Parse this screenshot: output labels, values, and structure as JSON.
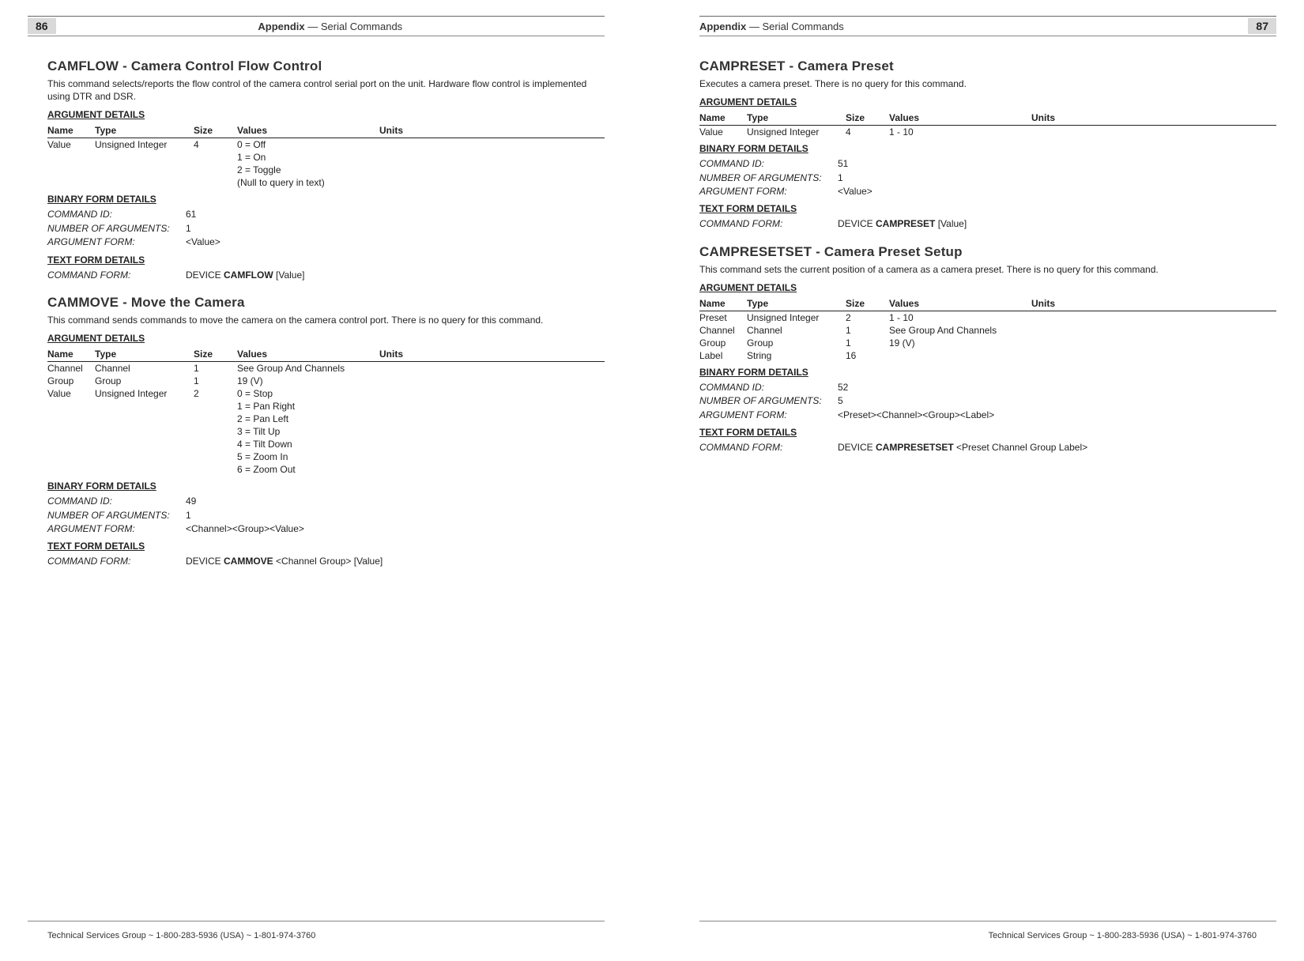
{
  "header": {
    "left_page_num": "86",
    "right_page_num": "87",
    "section_bold": "Appendix",
    "section_sep": " — ",
    "section_tail": "Serial Commands"
  },
  "footer": "Technical Services Group ~ 1-800-283-5936 (USA) ~ 1-801-974-3760",
  "labels": {
    "arg_details": "ARGUMENT DETAILS",
    "bin_details": "BINARY FORM DETAILS",
    "txt_details": "TEXT FORM DETAILS",
    "col_name": "Name",
    "col_type": "Type",
    "col_size": "Size",
    "col_values": "Values",
    "col_units": "Units",
    "cmd_id": "COMMAND ID:",
    "num_args": "NUMBER OF ARGUMENTS:",
    "arg_form": "ARGUMENT FORM:",
    "cmd_form": "COMMAND FORM:",
    "device": "DEVICE "
  },
  "camflow": {
    "title": "CAMFLOW - Camera Control Flow Control",
    "desc": "This command selects/reports the flow control of the camera control serial port on the unit. Hardware flow control is implemented using DTR and DSR.",
    "rows": [
      {
        "name": "Value",
        "type": "Unsigned Integer",
        "size": "4",
        "values": "0 = Off",
        "units": ""
      },
      {
        "name": "",
        "type": "",
        "size": "",
        "values": "1 = On",
        "units": ""
      },
      {
        "name": "",
        "type": "",
        "size": "",
        "values": "2 = Toggle",
        "units": ""
      },
      {
        "name": "",
        "type": "",
        "size": "",
        "values": "(Null to query in text)",
        "units": ""
      }
    ],
    "bin": {
      "cmd_id": "61",
      "num_args": "1",
      "arg_form": "<Value>"
    },
    "txt": {
      "cmd_bold": "CAMFLOW",
      "cmd_tail": " [Value]"
    }
  },
  "cammove": {
    "title": "CAMMOVE - Move the Camera",
    "desc": "This command sends commands to move the camera on the camera control port. There is no query for this command.",
    "rows": [
      {
        "name": "Channel",
        "type": "Channel",
        "size": "1",
        "values": "See Group And Channels",
        "units": ""
      },
      {
        "name": "Group",
        "type": "Group",
        "size": "1",
        "values": "19 (V)",
        "units": ""
      },
      {
        "name": "Value",
        "type": "Unsigned Integer",
        "size": "2",
        "values": "0 = Stop",
        "units": ""
      },
      {
        "name": "",
        "type": "",
        "size": "",
        "values": "1 = Pan Right",
        "units": ""
      },
      {
        "name": "",
        "type": "",
        "size": "",
        "values": "2 = Pan Left",
        "units": ""
      },
      {
        "name": "",
        "type": "",
        "size": "",
        "values": "3 = Tilt Up",
        "units": ""
      },
      {
        "name": "",
        "type": "",
        "size": "",
        "values": "4 = Tilt Down",
        "units": ""
      },
      {
        "name": "",
        "type": "",
        "size": "",
        "values": "5 = Zoom In",
        "units": ""
      },
      {
        "name": "",
        "type": "",
        "size": "",
        "values": "6 = Zoom Out",
        "units": ""
      }
    ],
    "bin": {
      "cmd_id": "49",
      "num_args": "1",
      "arg_form": "<Channel><Group><Value>"
    },
    "txt": {
      "cmd_bold": "CAMMOVE",
      "cmd_tail": " <Channel Group> [Value]"
    }
  },
  "campreset": {
    "title": "CAMPRESET - Camera Preset",
    "desc": "Executes a camera preset. There is no query for this command.",
    "rows": [
      {
        "name": "Value",
        "type": "Unsigned Integer",
        "size": "4",
        "values": "1 - 10",
        "units": ""
      }
    ],
    "bin": {
      "cmd_id": "51",
      "num_args": "1",
      "arg_form": "<Value>"
    },
    "txt": {
      "cmd_bold": "CAMPRESET",
      "cmd_tail": " [Value]"
    }
  },
  "campresetset": {
    "title": "CAMPRESETSET - Camera Preset Setup",
    "desc": "This command sets the current position of a camera as a camera preset. There is no query for this command.",
    "rows": [
      {
        "name": "Preset",
        "type": "Unsigned Integer",
        "size": "2",
        "values": "1 - 10",
        "units": ""
      },
      {
        "name": "Channel",
        "type": "Channel",
        "size": "1",
        "values": "See Group And Channels",
        "units": ""
      },
      {
        "name": "Group",
        "type": "Group",
        "size": "1",
        "values": "19 (V)",
        "units": ""
      },
      {
        "name": "Label",
        "type": "String",
        "size": "16",
        "values": "",
        "units": ""
      }
    ],
    "bin": {
      "cmd_id": "52",
      "num_args": "5",
      "arg_form": "<Preset><Channel><Group><Label>"
    },
    "txt": {
      "cmd_bold": "CAMPRESETSET",
      "cmd_tail": " <Preset Channel Group Label>"
    }
  }
}
